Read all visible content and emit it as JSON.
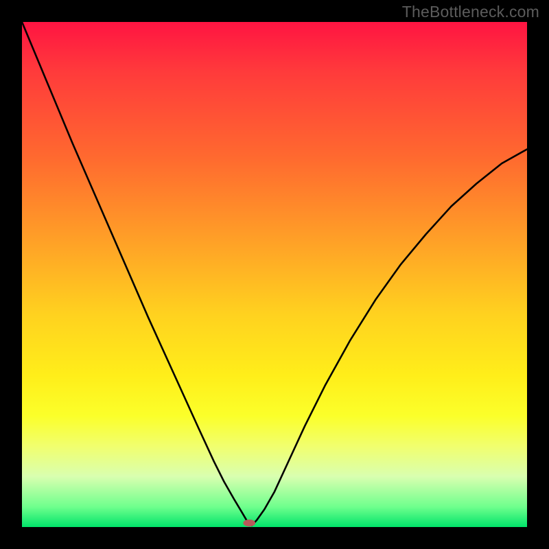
{
  "watermark": "TheBottleneck.com",
  "chart_data": {
    "type": "line",
    "title": "",
    "xlabel": "",
    "ylabel": "",
    "xlim": [
      0,
      100
    ],
    "ylim": [
      0,
      100
    ],
    "background_gradient": {
      "direction": "top-to-bottom",
      "stops": [
        {
          "pct": 0,
          "color": "#ff1442"
        },
        {
          "pct": 10,
          "color": "#ff3b3b"
        },
        {
          "pct": 27,
          "color": "#ff6a2f"
        },
        {
          "pct": 45,
          "color": "#ffa626"
        },
        {
          "pct": 58,
          "color": "#ffd21f"
        },
        {
          "pct": 70,
          "color": "#ffee1a"
        },
        {
          "pct": 78,
          "color": "#fbff2a"
        },
        {
          "pct": 84,
          "color": "#f1ff6e"
        },
        {
          "pct": 90,
          "color": "#d9ffb0"
        },
        {
          "pct": 96,
          "color": "#6fff8d"
        },
        {
          "pct": 100,
          "color": "#00e46a"
        }
      ]
    },
    "series": [
      {
        "name": "bottleneck-curve-left",
        "x": [
          0,
          5,
          10,
          15,
          20,
          25,
          30,
          35,
          38,
          40,
          42,
          43.5,
          44.5,
          45
        ],
        "y": [
          100,
          88,
          76,
          64.5,
          53,
          41.5,
          30.5,
          19.5,
          13,
          9,
          5.5,
          3,
          1.3,
          0.3
        ]
      },
      {
        "name": "bottleneck-curve-right",
        "x": [
          45.5,
          46.5,
          48,
          50,
          53,
          56,
          60,
          65,
          70,
          75,
          80,
          85,
          90,
          95,
          100
        ],
        "y": [
          0.3,
          1.4,
          3.5,
          7,
          13.5,
          20,
          28,
          37,
          45,
          52,
          58,
          63.5,
          68,
          72,
          74.8
        ]
      }
    ],
    "marker": {
      "name": "optimal-point",
      "x": 45,
      "y": 0.8,
      "rx": 1.2,
      "ry": 0.7,
      "color": "#b85a5a"
    }
  }
}
